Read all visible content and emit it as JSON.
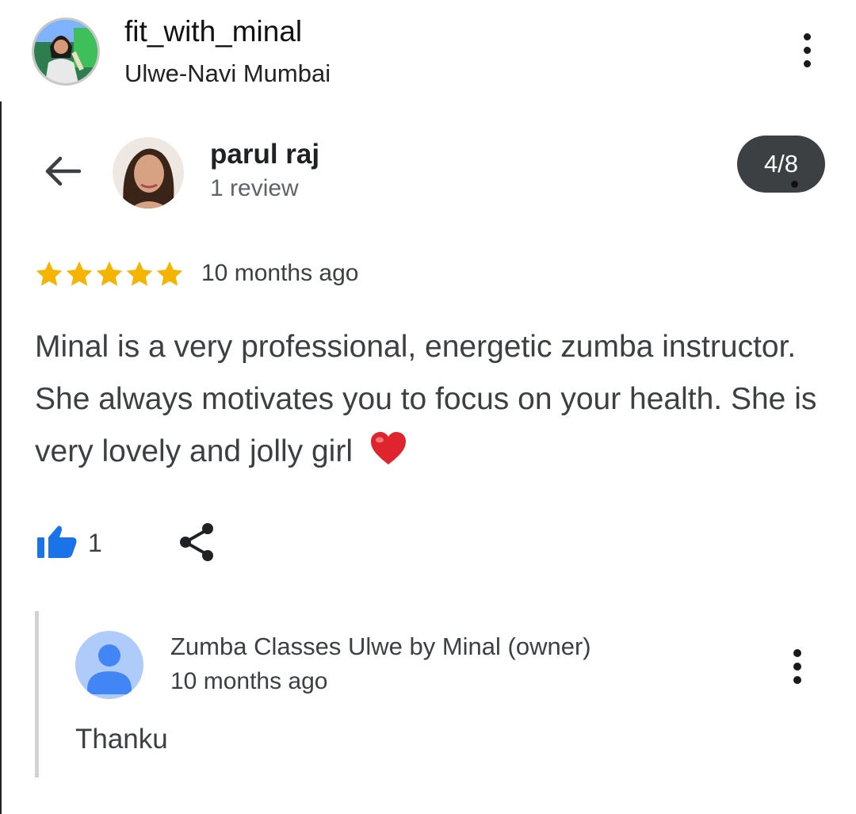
{
  "header": {
    "username": "fit_with_minal",
    "location": "Ulwe-Navi Mumbai",
    "avatar": "profile-photo",
    "more_icon": "more-vert-icon"
  },
  "review": {
    "reviewer_name": "parul raj",
    "reviewer_meta": "1 review",
    "counter": "4/8",
    "rating": 5,
    "rating_max": 5,
    "time": "10 months ago",
    "text": "Minal is a very professional, energetic zumba instructor. She always motivates you to focus on your health. She is very lovely and jolly girl",
    "emoji": "❤️",
    "like_count": "1",
    "icons": {
      "back": "back-arrow-icon",
      "like": "thumbs-up-icon",
      "share": "share-icon"
    }
  },
  "reply": {
    "owner_name": "Zumba Classes Ulwe by Minal (owner)",
    "time": "10 months ago",
    "text": "Thanku",
    "avatar": "default-person-avatar",
    "more_icon": "more-vert-icon"
  },
  "colors": {
    "star": "#f4b400",
    "like": "#1a73e8",
    "counter_bg": "#3c4043",
    "owner_avatar_bg": "#aecbfa",
    "owner_avatar_fg": "#4285f4"
  }
}
